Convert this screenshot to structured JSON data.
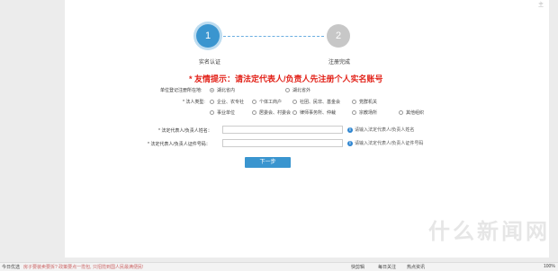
{
  "steps": [
    {
      "number": "1",
      "label": "实名认证"
    },
    {
      "number": "2",
      "label": "注册完成"
    }
  ],
  "notice": "* 友情提示：请法定代表人/负责人先注册个人实名账号",
  "location": {
    "label": "单位登记注册所在地:",
    "options": [
      {
        "label": "湖北省内",
        "selected": true
      },
      {
        "label": "湖北省外",
        "selected": false
      }
    ]
  },
  "legal_type": {
    "label": "* 法人类型:",
    "options": [
      {
        "label": "企业、农专社",
        "selected": false
      },
      {
        "label": "个体工商户",
        "selected": false
      },
      {
        "label": "社团、民非、基金会",
        "selected": false
      },
      {
        "label": "党群机关",
        "selected": false
      },
      {
        "label": "事业单位",
        "selected": false
      },
      {
        "label": "居委会、村委会",
        "selected": false
      },
      {
        "label": "律师事务所、仲裁",
        "selected": false
      },
      {
        "label": "宗教场所",
        "selected": false
      },
      {
        "label": "其他组织",
        "selected": false
      }
    ]
  },
  "name_field": {
    "label": "* 法定代表人/负责人姓名：",
    "value": "",
    "hint": "请输入法定代表人/负责人姓名"
  },
  "id_field": {
    "label": "* 法定代表人/负责人证件号码：",
    "value": "",
    "hint": "请输入法定代表人/负责人证件号码"
  },
  "next_button": "下一步",
  "statusbar": {
    "left": "今日优选",
    "news": "房子要装卖要拆? 政策要点一揽包, 只招揽到国人民最满便民!",
    "items": [
      "快剪辑",
      "每日关注",
      "热点资讯"
    ],
    "zoom": "100%"
  },
  "watermark": "什么新闻网",
  "corner_text": "主"
}
